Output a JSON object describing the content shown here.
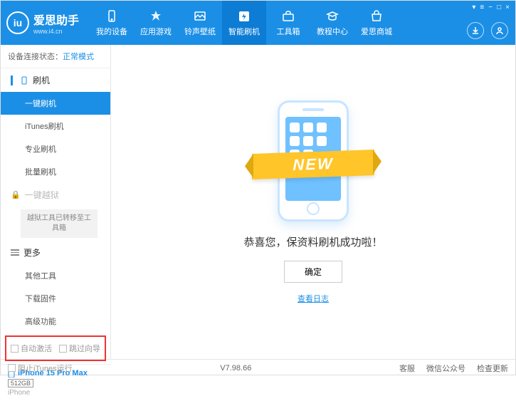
{
  "header": {
    "app_name": "爱思助手",
    "app_url": "www.i4.cn",
    "nav": [
      {
        "label": "我的设备"
      },
      {
        "label": "应用游戏"
      },
      {
        "label": "铃声壁纸"
      },
      {
        "label": "智能刷机"
      },
      {
        "label": "工具箱"
      },
      {
        "label": "教程中心"
      },
      {
        "label": "爱思商城"
      }
    ]
  },
  "sidebar": {
    "status_label": "设备连接状态：",
    "status_value": "正常模式",
    "flash_section": "刷机",
    "items": {
      "one_key": "一键刷机",
      "itunes": "iTunes刷机",
      "pro": "专业刷机",
      "batch": "批量刷机"
    },
    "jailbreak_section": "一键越狱",
    "jailbreak_note": "越狱工具已转移至工具箱",
    "more_section": "更多",
    "more_items": {
      "other": "其他工具",
      "download": "下载固件",
      "advanced": "高级功能"
    },
    "checkbox": {
      "auto_activate": "自动激活",
      "skip_guide": "跳过向导"
    },
    "device": {
      "name": "iPhone 15 Pro Max",
      "storage": "512GB",
      "type": "iPhone"
    }
  },
  "main": {
    "ribbon": "NEW",
    "success": "恭喜您，保资料刷机成功啦！",
    "ok": "确定",
    "log": "查看日志"
  },
  "footer": {
    "block_itunes": "阻止iTunes运行",
    "version": "V7.98.66",
    "links": {
      "service": "客服",
      "wechat": "微信公众号",
      "update": "检查更新"
    }
  }
}
